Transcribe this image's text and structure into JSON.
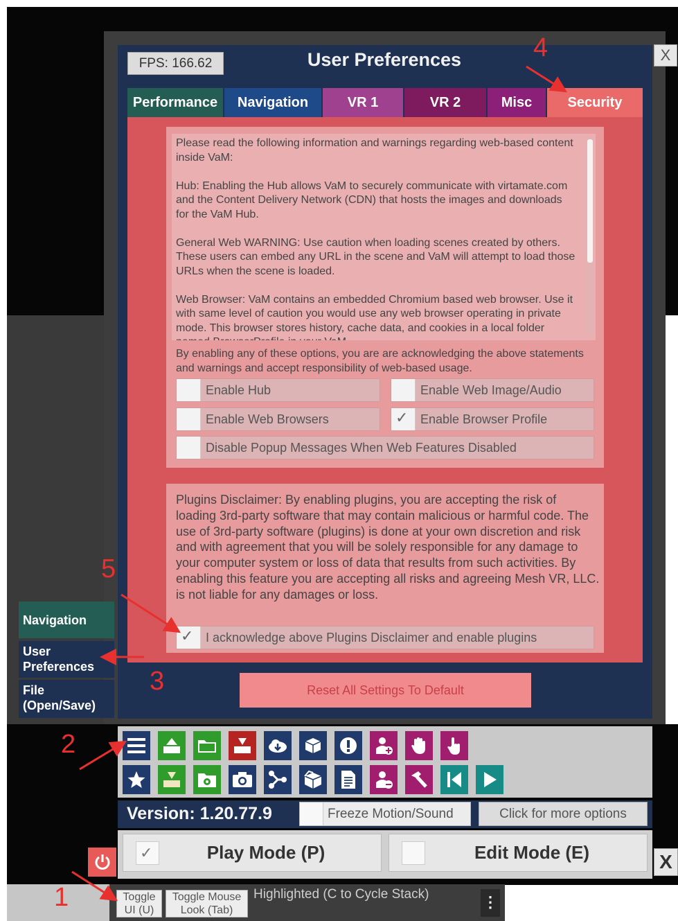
{
  "header": {
    "fps": "FPS: 166.62",
    "title": "User Preferences",
    "close": "X"
  },
  "tabs": [
    "Performance",
    "Navigation",
    "VR 1",
    "VR 2",
    "Misc",
    "Security"
  ],
  "web_section": {
    "info_text": "Please read the following information and warnings regarding web-based content inside VaM:\n\nHub: Enabling the Hub allows VaM to securely communicate with virtamate.com and the Content Delivery Network (CDN) that hosts the images and downloads for the VaM Hub.\n\nGeneral Web WARNING: Use caution when loading scenes created by others. These users can embed any URL in the scene and VaM will attempt to load those URLs when the scene is loaded.\n\nWeb Browser: VaM contains an embedded Chromium based web browser. Use it with same level of caution you would use any web browser operating in private mode. This browser stores history, cache data, and cookies in a local folder named BrowserProfile in your VaM",
    "acknowledge_text": "By enabling any of these options, you are are acknowledging the above statements and warnings and accept responsibility of web-based usage.",
    "options": {
      "enable_hub": "Enable Hub",
      "enable_web_image_audio": "Enable Web Image/Audio",
      "enable_web_browsers": "Enable Web Browsers",
      "enable_browser_profile": "Enable Browser Profile",
      "disable_popup": "Disable Popup Messages When Web Features Disabled"
    },
    "checked": {
      "enable_browser_profile": true
    }
  },
  "plugins": {
    "disclaimer": "Plugins Disclaimer: By enabling plugins, you are accepting the risk of loading 3rd-party software that may contain malicious or harmful code. The use of 3rd-party software (plugins) is done at your own discretion and risk and with agreement that you will be solely responsible for any damage to your computer system or loss of data that results from such activities. By enabling this feature you are accepting all risks and agreeing Mesh VR, LLC. is not liable for any damages or loss.",
    "acknowledge_label": "I acknowledge above Plugins Disclaimer and enable plugins",
    "checked": true
  },
  "reset_button": "Reset All Settings To Default",
  "left_nav": {
    "navigation": "Navigation",
    "user_preferences": "User Preferences",
    "file": "File (Open/Save)"
  },
  "toolbar": {
    "version": "Version: 1.20.77.9",
    "freeze": "Freeze Motion/Sound",
    "more_options": "Click for more options",
    "icons_row1": [
      "menu-icon",
      "scene-load-icon",
      "folder-icon",
      "scene-red-icon",
      "cloud-download-icon",
      "package-icon",
      "alert-icon",
      "add-person-icon",
      "hand-icon",
      "pointer-hand-icon"
    ],
    "icons_row2": [
      "star-icon",
      "scene-save-icon",
      "folder-gear-icon",
      "camera-icon",
      "node-icon",
      "package-open-icon",
      "document-icon",
      "remove-person-icon",
      "hammer-icon",
      "skip-back-icon",
      "play-icon"
    ]
  },
  "modes": {
    "play": "Play Mode (P)",
    "edit": "Edit Mode (E)",
    "play_checked": true,
    "close": "X"
  },
  "bottom_bar": {
    "toggle_ui": "Toggle\nUI (U)",
    "toggle_mouse": "Toggle Mouse\nLook (Tab)",
    "highlighted": "Highlighted (C to Cycle Stack)",
    "more": "⋮"
  },
  "annotations": [
    "1",
    "2",
    "3",
    "4",
    "5"
  ],
  "colors": {
    "security_tab": "#ea6a6a",
    "content_bg": "#d6565b",
    "panel_bg": "#1f3152",
    "annotation": "#e8302e"
  }
}
